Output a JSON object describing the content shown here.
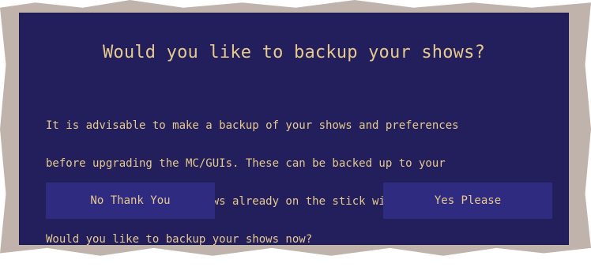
{
  "dialog": {
    "title": "Would you like to backup your shows?",
    "message_lines": [
      "It is advisable to make a backup of your shows and preferences",
      "before upgrading the MC/GUIs. These can be backed up to your",
      "USB memory stick. Any shows already on the stick will be overwritten.",
      "Would you like to backup your shows now?"
    ],
    "buttons": {
      "no_label": "No Thank You",
      "yes_label": "Yes Please"
    }
  },
  "colors": {
    "frame": "#bfb3ac",
    "dialog_bg": "#231f5c",
    "button_bg": "#2f2b80",
    "text": "#e6c98d"
  }
}
